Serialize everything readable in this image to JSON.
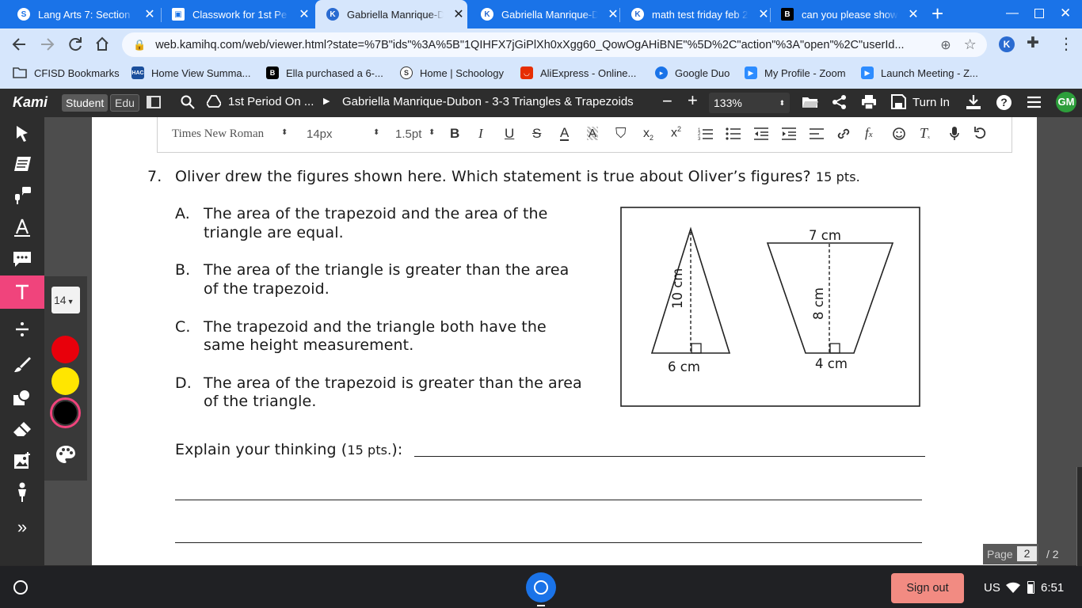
{
  "browser": {
    "tabs": [
      {
        "title": "Lang Arts 7: Section",
        "icon": "schoology-icon"
      },
      {
        "title": "Classwork for 1st Pe",
        "icon": "classroom-icon"
      },
      {
        "title": "Gabriella Manrique-D",
        "icon": "kami-icon",
        "active": true
      },
      {
        "title": "Gabriella Manrique-D",
        "icon": "kami-icon"
      },
      {
        "title": "math test friday feb 2",
        "icon": "kami-icon"
      },
      {
        "title": "can you please show",
        "icon": "brainly-icon"
      }
    ],
    "url": "web.kamihq.com/web/viewer.html?state=%7B\"ids\"%3A%5B\"1QIHFX7jGiPlXh0xXgg60_QowOgAHiBNE\"%5D%2C\"action\"%3A\"open\"%2C\"userId...",
    "bookmarks": [
      {
        "label": "CFISD Bookmarks",
        "icon": "folder-icon"
      },
      {
        "label": "Home View Summa...",
        "icon": "hac-icon"
      },
      {
        "label": "Ella purchased a 6-...",
        "icon": "brainly-icon"
      },
      {
        "label": "Home | Schoology",
        "icon": "schoology-icon"
      },
      {
        "label": "AliExpress - Online...",
        "icon": "aliexpress-icon"
      },
      {
        "label": "Google Duo",
        "icon": "duo-icon"
      },
      {
        "label": "My Profile - Zoom",
        "icon": "zoom-icon"
      },
      {
        "label": "Launch Meeting - Z...",
        "icon": "zoom-icon"
      }
    ]
  },
  "kami": {
    "logo": "Kami",
    "role_student": "Student",
    "role_edu": "Edu",
    "folder_label": "1st Period On ...",
    "doc_title": "Gabriella Manrique-Dubon - 3-3 Triangles & Trapezoids",
    "zoom": "133%",
    "turn_in": "Turn In",
    "avatar": "GM",
    "font_size_picker": "14",
    "colors": [
      "#e8000b",
      "#ffe600",
      "#000000"
    ],
    "format_toolbar": {
      "font": "Times New Roman",
      "size": "14px",
      "line_height": "1.5pt"
    },
    "page_label": "Page",
    "page_current": "2",
    "page_total": "/ 2"
  },
  "document": {
    "question_number": "7.",
    "question_text": "Oliver drew the figures shown here. Which statement is true about Oliver’s figures?",
    "question_points": "15 pts.",
    "options": [
      {
        "letter": "A.",
        "line1": "The area of the trapezoid and the area of the",
        "line2": "triangle are equal."
      },
      {
        "letter": "B.",
        "line1": "The area of the triangle is greater than the area",
        "line2": "of the trapezoid."
      },
      {
        "letter": "C.",
        "line1": "The trapezoid and the triangle both have the",
        "line2": "same height measurement."
      },
      {
        "letter": "D.",
        "line1": "The area of the trapezoid is greater than the area",
        "line2": "of the triangle."
      }
    ],
    "figure": {
      "triangle_height": "10 cm",
      "triangle_base": "6 cm",
      "trapezoid_top": "7 cm",
      "trapezoid_height": "8 cm",
      "trapezoid_bottom": "4 cm"
    },
    "explain_label": "Explain your thinking (",
    "explain_points": "15 pts.",
    "explain_end": "):"
  },
  "taskbar": {
    "sign_out": "Sign out",
    "locale": "US",
    "time": "6:51"
  }
}
